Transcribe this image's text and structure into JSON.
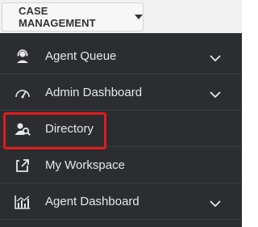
{
  "app_switcher": {
    "label": "CASE MANAGEMENT",
    "caret_icon": "caret-down-icon"
  },
  "sidebar": {
    "items": [
      {
        "label": "Agent Queue",
        "icon": "agent-headset-icon",
        "expandable": true
      },
      {
        "label": "Admin Dashboard",
        "icon": "gauge-icon",
        "expandable": true
      },
      {
        "label": "Directory",
        "icon": "person-search-icon",
        "expandable": false,
        "highlighted": true
      },
      {
        "label": "My Workspace",
        "icon": "workspace-export-icon",
        "expandable": false
      },
      {
        "label": "Agent Dashboard",
        "icon": "chart-icon",
        "expandable": true
      }
    ]
  },
  "colors": {
    "sidebar_bg": "#2b2d30",
    "topbar_bg": "#f1f1f1",
    "item_text": "#e8e8e8",
    "highlight": "#e21a1a"
  }
}
